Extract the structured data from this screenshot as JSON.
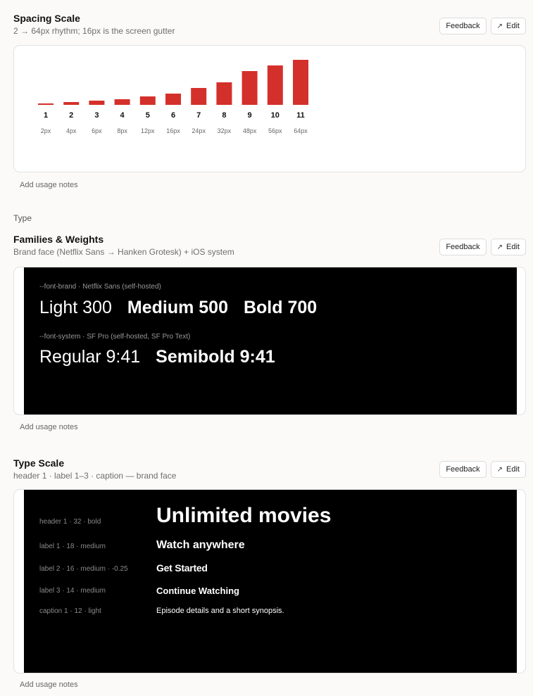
{
  "buttons": {
    "feedback": "Feedback",
    "edit": "Edit"
  },
  "usage_notes": "Add usage notes",
  "group_label": "Type",
  "spacing": {
    "title": "Spacing Scale",
    "subtitle": "2 → 64px rhythm; 16px is the screen gutter",
    "chart_data": {
      "type": "bar",
      "categories": [
        "1",
        "2",
        "3",
        "4",
        "5",
        "6",
        "7",
        "8",
        "9",
        "10",
        "11"
      ],
      "values": [
        2,
        4,
        6,
        8,
        12,
        16,
        24,
        32,
        48,
        56,
        64
      ],
      "value_labels": [
        "2px",
        "4px",
        "6px",
        "8px",
        "12px",
        "16px",
        "24px",
        "32px",
        "48px",
        "56px",
        "64px"
      ]
    }
  },
  "families": {
    "title": "Families & Weights",
    "subtitle": "Brand face (Netflix Sans → Hanken Grotesk) + iOS system",
    "brand_label": "--font-brand · Netflix Sans (self-hosted)",
    "brand_samples": [
      "Light 300",
      "Medium 500",
      "Bold 700"
    ],
    "system_label": "--font-system · SF Pro (self-hosted, SF Pro Text)",
    "system_samples": [
      "Regular 9:41",
      "Semibold 9:41"
    ]
  },
  "typescale": {
    "title": "Type Scale",
    "subtitle": "header 1 · label 1–3 · caption — brand face",
    "rows": [
      {
        "meta": "header 1 · 32 · bold",
        "sample": "Unlimited movies"
      },
      {
        "meta": "label 1 · 18 · medium",
        "sample": "Watch anywhere"
      },
      {
        "meta": "label 2 · 16 · medium · -0.25",
        "sample": "Get Started"
      },
      {
        "meta": "label 3 · 14 · medium",
        "sample": "Continue Watching"
      },
      {
        "meta": "caption 1 · 12 · light",
        "sample": "Episode details and a short synopsis."
      }
    ]
  }
}
